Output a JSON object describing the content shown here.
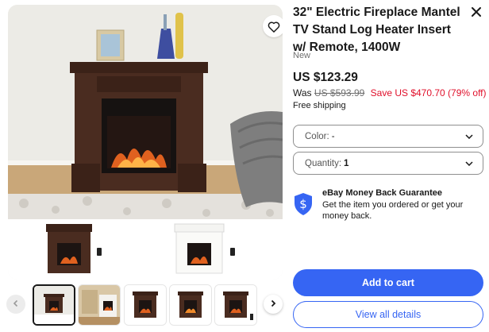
{
  "product": {
    "title": "32\" Electric Fireplace Mantel TV Stand Log Heater Insert w/ Remote, 1400W",
    "condition": "New",
    "price": "US $123.29",
    "was_label": "Was",
    "was_price": "US $593.99",
    "save_text": "Save US $470.70 (79% off)",
    "shipping": "Free shipping"
  },
  "selects": {
    "color": {
      "label": "Color:",
      "value": "-"
    },
    "quantity": {
      "label": "Quantity:",
      "value": "1"
    }
  },
  "guarantee": {
    "title": "eBay Money Back Guarantee",
    "text": "Get the item you ordered or get your money back."
  },
  "buttons": {
    "add_to_cart": "Add to cart",
    "view_details": "View all details"
  },
  "gallery": {
    "thumbnail_count": 5,
    "selected_index": 0
  },
  "icons": {
    "wishlist": "heart-icon",
    "close": "close-icon",
    "prev": "chevron-left-icon",
    "next": "chevron-right-icon",
    "dropdown": "chevron-down-icon",
    "guarantee": "shield-dollar-icon"
  },
  "colors": {
    "primary": "#3665f3",
    "save_red": "#e0102b",
    "shield": "#3665f3",
    "fireplace_wood": "#3b2218"
  }
}
